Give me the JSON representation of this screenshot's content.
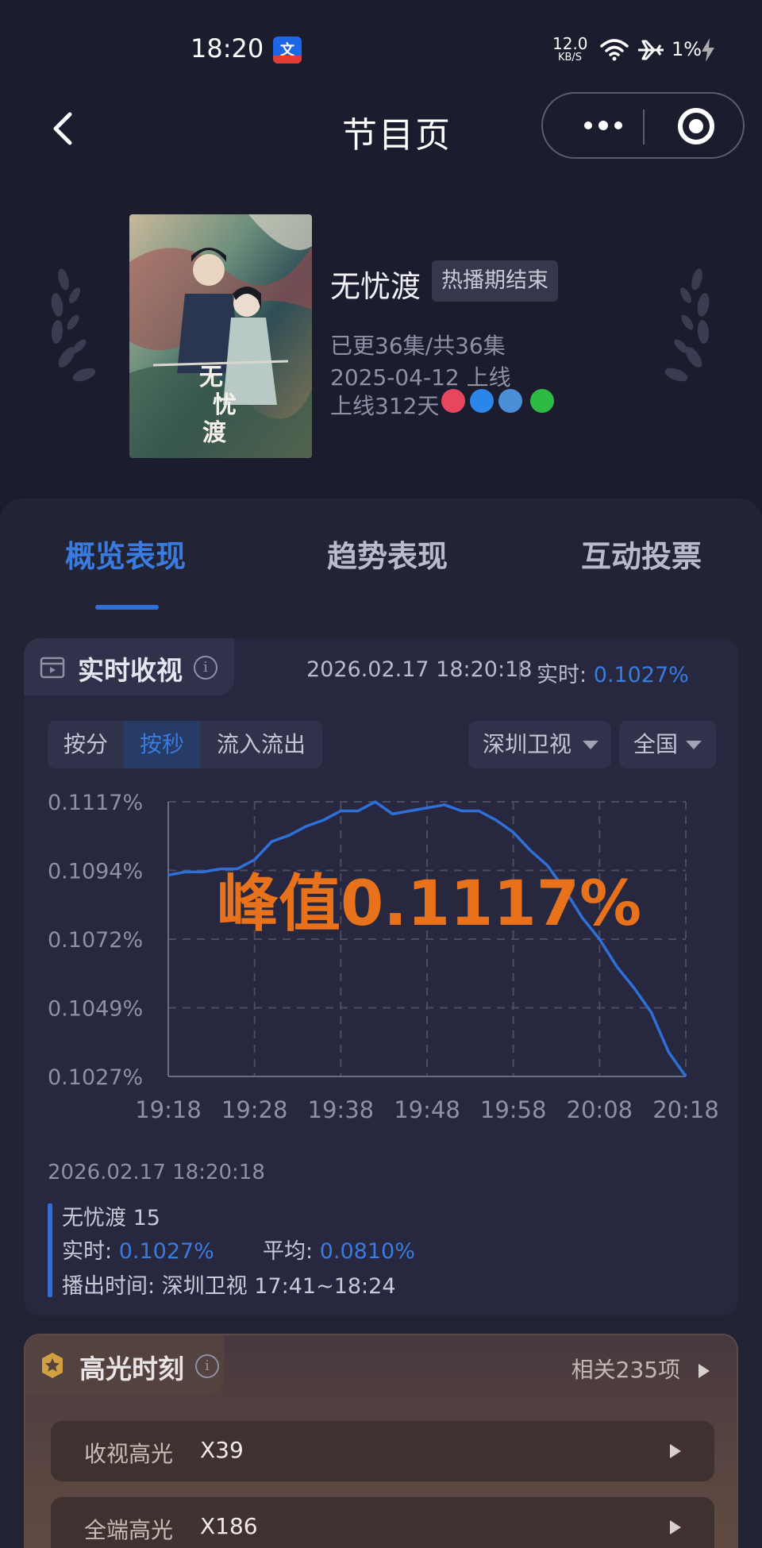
{
  "status_bar": {
    "time": "18:20",
    "net_speed": "12.0",
    "net_unit": "KB/S",
    "battery": "1%"
  },
  "nav": {
    "title": "节目页"
  },
  "show": {
    "name": "无忧渡",
    "tag": "热播期结束",
    "episodes": "已更36集/共36集",
    "release": "2025-04-12 上线",
    "days_online": "上线312天",
    "platforms": [
      "tencent-video-icon",
      "youku-icon",
      "mango-tv-icon",
      "iqiyi-icon"
    ]
  },
  "tabs": [
    {
      "label": "概览表现",
      "active": true
    },
    {
      "label": "趋势表现",
      "active": false
    },
    {
      "label": "互动投票",
      "active": false
    }
  ],
  "realtime": {
    "title": "实时收视",
    "timestamp": "2026.02.17 18:20:18",
    "realtime_label": "实时:",
    "realtime_value": "0.1027%",
    "segments": [
      "按分",
      "按秒",
      "流入流出"
    ],
    "active_segment": "按秒",
    "channel": "深圳卫视",
    "region": "全国"
  },
  "chart_data": {
    "type": "line",
    "x": [
      "19:18",
      "19:20",
      "19:22",
      "19:24",
      "19:26",
      "19:28",
      "19:30",
      "19:32",
      "19:34",
      "19:36",
      "19:38",
      "19:40",
      "19:42",
      "19:44",
      "19:46",
      "19:48",
      "19:50",
      "19:52",
      "19:54",
      "19:56",
      "19:58",
      "20:00",
      "20:02",
      "20:04",
      "20:06",
      "20:08",
      "20:10",
      "20:12",
      "20:14",
      "20:16",
      "20:18"
    ],
    "values": [
      0.1093,
      0.1094,
      0.1094,
      0.1095,
      0.1095,
      0.1098,
      0.1104,
      0.1106,
      0.1109,
      0.1111,
      0.1114,
      0.1114,
      0.1117,
      0.1113,
      0.1114,
      0.1115,
      0.1116,
      0.1114,
      0.1114,
      0.1111,
      0.1107,
      0.1101,
      0.1096,
      0.1088,
      0.1079,
      0.1072,
      0.1063,
      0.1056,
      0.1048,
      0.1035,
      0.1027
    ],
    "x_ticks": [
      "19:18",
      "19:28",
      "19:38",
      "19:48",
      "19:58",
      "20:08",
      "20:18"
    ],
    "y_ticks": [
      "0.1117%",
      "0.1094%",
      "0.1072%",
      "0.1049%",
      "0.1027%"
    ],
    "ylim": [
      0.1027,
      0.1117
    ],
    "annotation": "峰值0.1117%",
    "line_color": "#2f6fd8",
    "annotation_color": "#e8721c"
  },
  "detail": {
    "timestamp": "2026.02.17 18:20:18",
    "episode": "无忧渡 15",
    "realtime_label": "实时:",
    "realtime_value": "0.1027%",
    "avg_label": "平均:",
    "avg_value": "0.0810%",
    "airtime": "播出时间:  深圳卫视 17:41~18:24"
  },
  "highlights": {
    "title": "高光时刻",
    "related": "相关235项",
    "rows": [
      {
        "label": "收视高光",
        "value": "X39"
      },
      {
        "label": "全端高光",
        "value": "X186"
      }
    ]
  }
}
